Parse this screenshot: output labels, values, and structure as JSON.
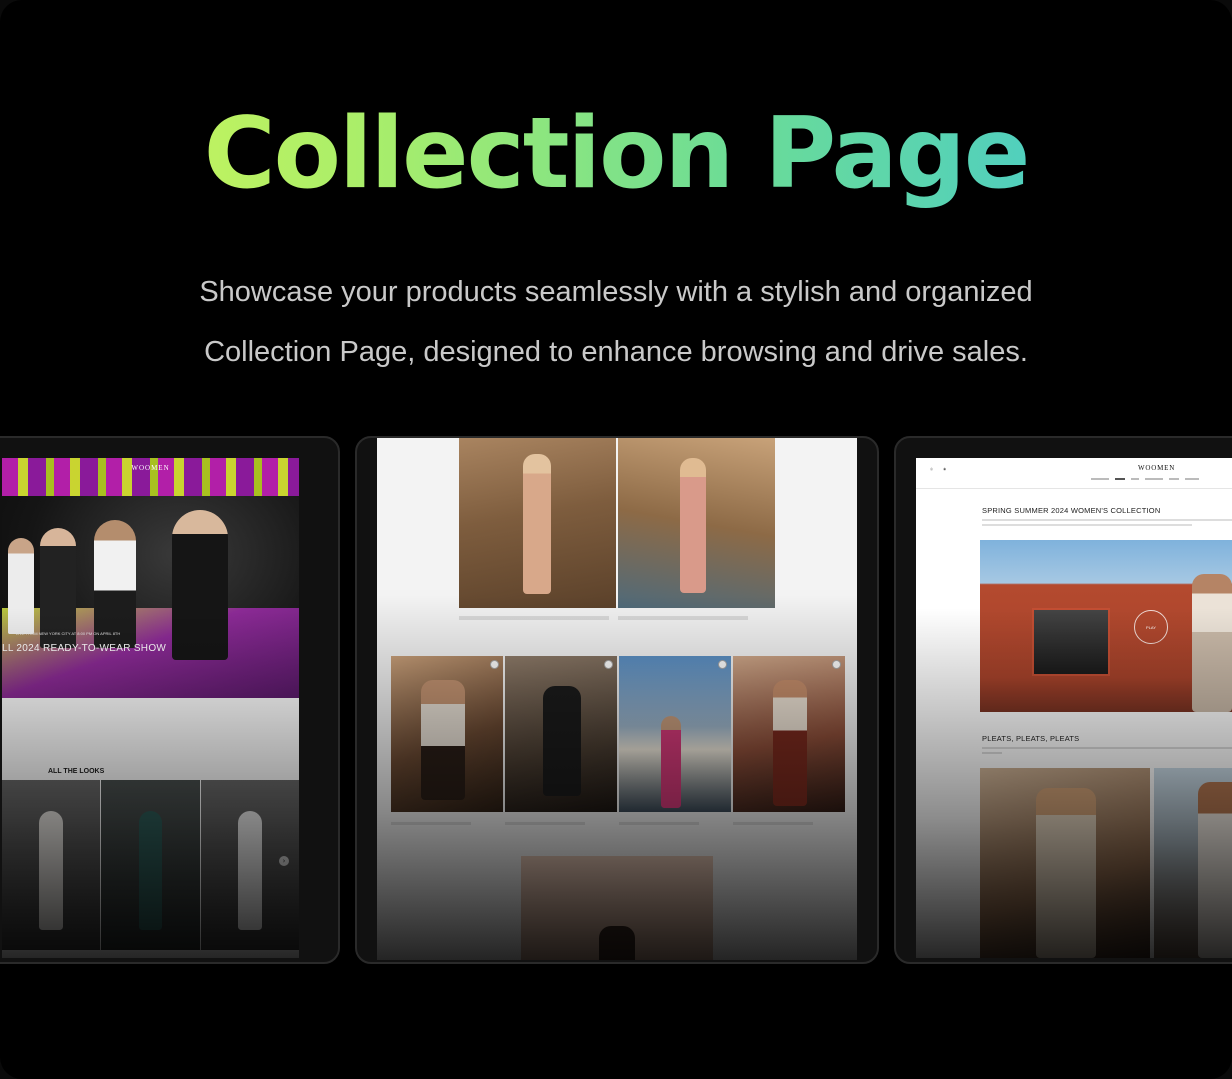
{
  "hero": {
    "title": "Collection Page",
    "subtitle_line1": "Showcase your products seamlessly with a stylish and organized",
    "subtitle_line2": "Collection Page, designed to enhance browsing and drive sales."
  },
  "colors": {
    "gradient_start": "#d6f756",
    "gradient_end": "#3fc6d8",
    "background": "#000000"
  },
  "screen1": {
    "brand": "WOOMEN",
    "show_date": "LIVE FROM NEW YORK CITY AT 8:00 PM ON APRIL 8TH",
    "show_title": "LL 2024 READY-TO-WEAR SHOW",
    "looks_title": "ALL THE LOOKS"
  },
  "screen3": {
    "brand": "WOOMEN",
    "section1_title": "SPRING SUMMER 2024 WOMEN'S COLLECTION",
    "video_label": "PLAY",
    "section2_title": "PLEATS, PLEATS, PLEATS"
  }
}
